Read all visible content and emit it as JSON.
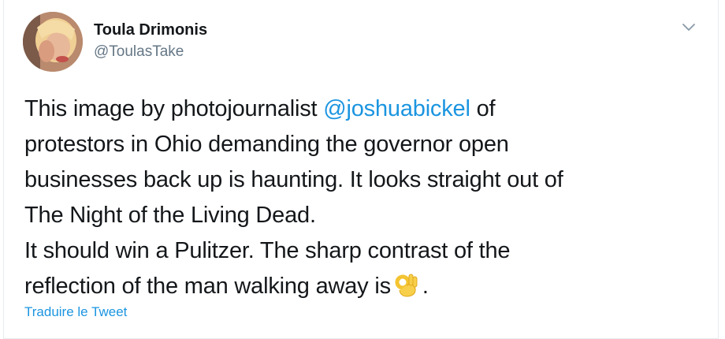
{
  "tweet": {
    "author": {
      "display_name": "Toula Drimonis",
      "handle": "@ToulasTake"
    },
    "menu_icon": "chevron-down-icon",
    "body": {
      "line1_before": "This image by photojournalist ",
      "line1_mention": "@joshuabickel",
      "line1_after": " of",
      "line2": "protestors in Ohio demanding the governor open",
      "line3": "businesses back up is haunting. It looks straight out of",
      "line4": "The Night of the Living Dead.",
      "line5": "It should win a Pulitzer. The sharp contrast of the",
      "line6_before": "reflection of the man walking away is",
      "line6_emoji": "ok-hand-emoji",
      "line6_after": "."
    },
    "translate_label": "Traduire le Tweet"
  },
  "colors": {
    "link": "#1b95e0",
    "text": "#14171a",
    "secondary": "#657786",
    "border": "#e6ecf0"
  }
}
